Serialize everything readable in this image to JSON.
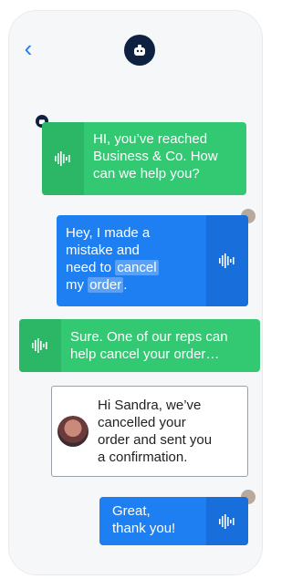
{
  "header": {
    "back_icon": "chevron-left-icon",
    "avatar_icon": "robot-icon"
  },
  "messages": [
    {
      "id": "m1",
      "sender": "bot",
      "lines": [
        "HI, you’ve reached",
        "Business & Co. How",
        "can we help you?"
      ]
    },
    {
      "id": "m2",
      "sender": "user",
      "lines": [
        "Hey, I made a",
        "mistake and",
        "need to",
        "cancel",
        "my",
        "order",
        "."
      ]
    },
    {
      "id": "m3",
      "sender": "bot",
      "lines": [
        "Sure. One of our reps can",
        "help cancel your order…"
      ]
    },
    {
      "id": "m4",
      "sender": "agent",
      "lines": [
        "Hi Sandra, we’ve",
        "cancelled your",
        "order and sent you",
        "a confirmation."
      ]
    },
    {
      "id": "m5",
      "sender": "user",
      "lines": [
        "Great,",
        "thank you!"
      ]
    }
  ],
  "colors": {
    "bot": "#33c973",
    "user": "#1e7ff2",
    "accent": "#1b7cff",
    "avatar": "#0f2140"
  }
}
